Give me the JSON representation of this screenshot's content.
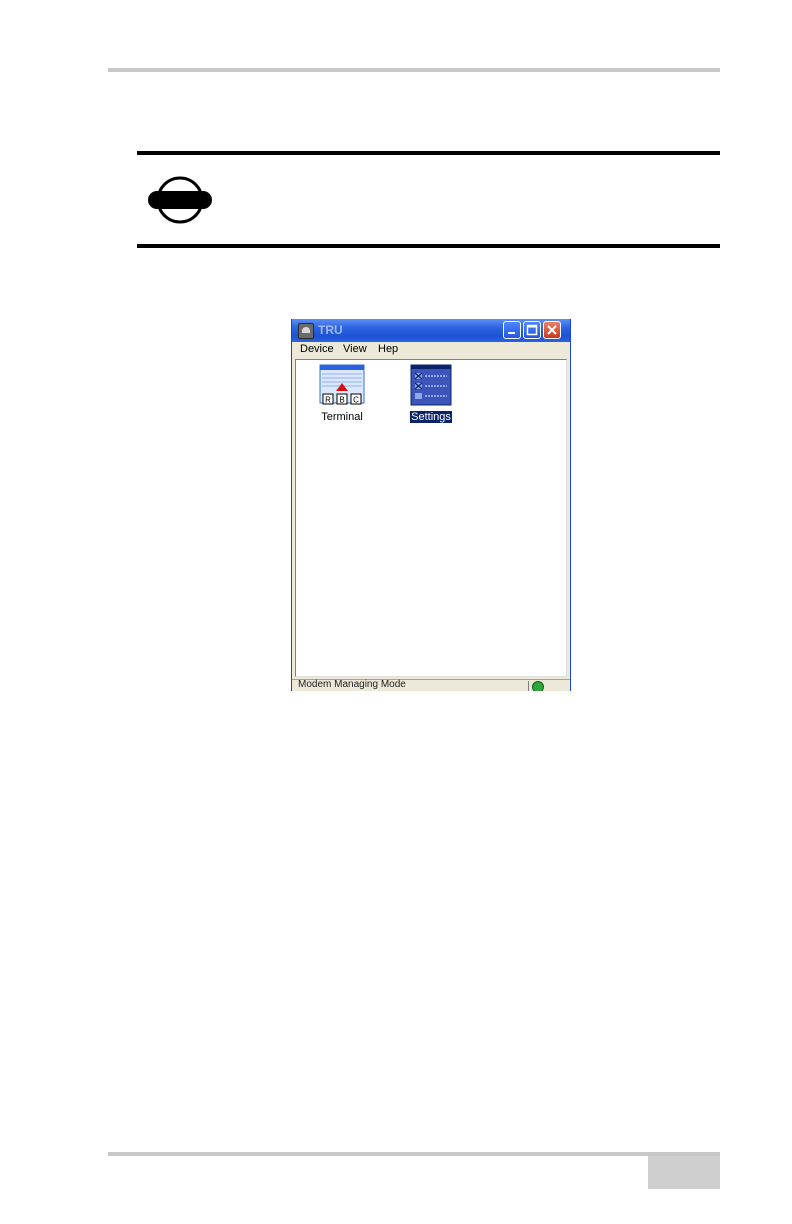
{
  "window": {
    "title": "TRU",
    "menu": [
      "Device",
      "View",
      "Hep"
    ]
  },
  "icons": [
    {
      "label": "Terminal",
      "icon": "terminal-abc-icon"
    },
    {
      "label": "Settings",
      "icon": "settings-checklist-icon",
      "selected": true
    }
  ],
  "statusbar": {
    "text": "Modem Managing Mode",
    "icon": "globe-connection-icon"
  },
  "colors": {
    "titlebar": "#2a62e0",
    "selection": "#0a246a",
    "notice_icon": "#000000"
  }
}
